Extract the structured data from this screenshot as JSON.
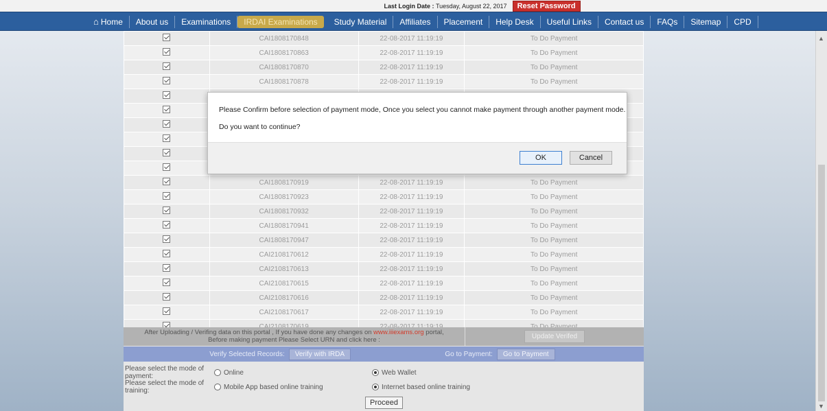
{
  "topbar": {
    "last_login_label": "Last Login Date :",
    "last_login_date": "Tuesday, August 22, 2017",
    "reset_password": "Reset Password"
  },
  "nav": {
    "items": [
      {
        "label": "Home",
        "icon": "home-icon"
      },
      {
        "label": "About us"
      },
      {
        "label": "Examinations"
      },
      {
        "label": "IRDAI Examinations",
        "active": true
      },
      {
        "label": "Study Material"
      },
      {
        "label": "Affiliates"
      },
      {
        "label": "Placement"
      },
      {
        "label": "Help Desk"
      },
      {
        "label": "Useful Links"
      },
      {
        "label": "Contact us"
      },
      {
        "label": "FAQs"
      },
      {
        "label": "Sitemap"
      },
      {
        "label": "CPD"
      }
    ]
  },
  "table": {
    "rows": [
      {
        "urn": "CAI1808170848",
        "date": "22-08-2017 11:19:19",
        "status": "To Do Payment"
      },
      {
        "urn": "CAI1808170863",
        "date": "22-08-2017 11:19:19",
        "status": "To Do Payment"
      },
      {
        "urn": "CAI1808170870",
        "date": "22-08-2017 11:19:19",
        "status": "To Do Payment"
      },
      {
        "urn": "CAI1808170878",
        "date": "22-08-2017 11:19:19",
        "status": "To Do Payment"
      },
      {
        "urn": "",
        "date": "",
        "status": ""
      },
      {
        "urn": "",
        "date": "",
        "status": ""
      },
      {
        "urn": "",
        "date": "",
        "status": ""
      },
      {
        "urn": "",
        "date": "",
        "status": ""
      },
      {
        "urn": "",
        "date": "",
        "status": ""
      },
      {
        "urn": "",
        "date": "",
        "status": ""
      },
      {
        "urn": "CAI1808170919",
        "date": "22-08-2017 11:19:19",
        "status": "To Do Payment"
      },
      {
        "urn": "CAI1808170923",
        "date": "22-08-2017 11:19:19",
        "status": "To Do Payment"
      },
      {
        "urn": "CAI1808170932",
        "date": "22-08-2017 11:19:19",
        "status": "To Do Payment"
      },
      {
        "urn": "CAI1808170941",
        "date": "22-08-2017 11:19:19",
        "status": "To Do Payment"
      },
      {
        "urn": "CAI1808170947",
        "date": "22-08-2017 11:19:19",
        "status": "To Do Payment"
      },
      {
        "urn": "CAI2108170612",
        "date": "22-08-2017 11:19:19",
        "status": "To Do Payment"
      },
      {
        "urn": "CAI2108170613",
        "date": "22-08-2017 11:19:19",
        "status": "To Do Payment"
      },
      {
        "urn": "CAI2108170615",
        "date": "22-08-2017 11:19:19",
        "status": "To Do Payment"
      },
      {
        "urn": "CAI2108170616",
        "date": "22-08-2017 11:19:19",
        "status": "To Do Payment"
      },
      {
        "urn": "CAI2108170617",
        "date": "22-08-2017 11:19:19",
        "status": "To Do Payment"
      },
      {
        "urn": "CAI2108170619",
        "date": "22-08-2017 11:19:19",
        "status": "To Do Payment"
      }
    ]
  },
  "notice": {
    "line1_prefix": "After Uploading / Verifing data on this portal , If you have done any changes on",
    "link": "www.iiiexams.org",
    "line1_suffix": "portal,",
    "line2": "Before making payment Please Select URN and click here :",
    "update_button": "Update Verifed"
  },
  "verify": {
    "label": "Verify Selected Records:",
    "button": "Verify with IRDA",
    "payment_label": "Go to Payment:",
    "payment_button": "Go to Payment"
  },
  "payment_mode": {
    "label": "Please select the mode of payment:",
    "options": [
      {
        "label": "Online",
        "selected": false
      },
      {
        "label": "Web Wallet",
        "selected": true
      }
    ]
  },
  "training_mode": {
    "label": "Please select the mode of training:",
    "options": [
      {
        "label": "Mobile App based online training",
        "selected": false
      },
      {
        "label": "Internet based online training",
        "selected": true
      }
    ]
  },
  "proceed_button": "Proceed",
  "dialog": {
    "message": "Please Confirm before selection of payment mode, Once you select you cannot make payment through another payment mode.",
    "question": "Do you want to continue?",
    "ok": "OK",
    "cancel": "Cancel"
  }
}
